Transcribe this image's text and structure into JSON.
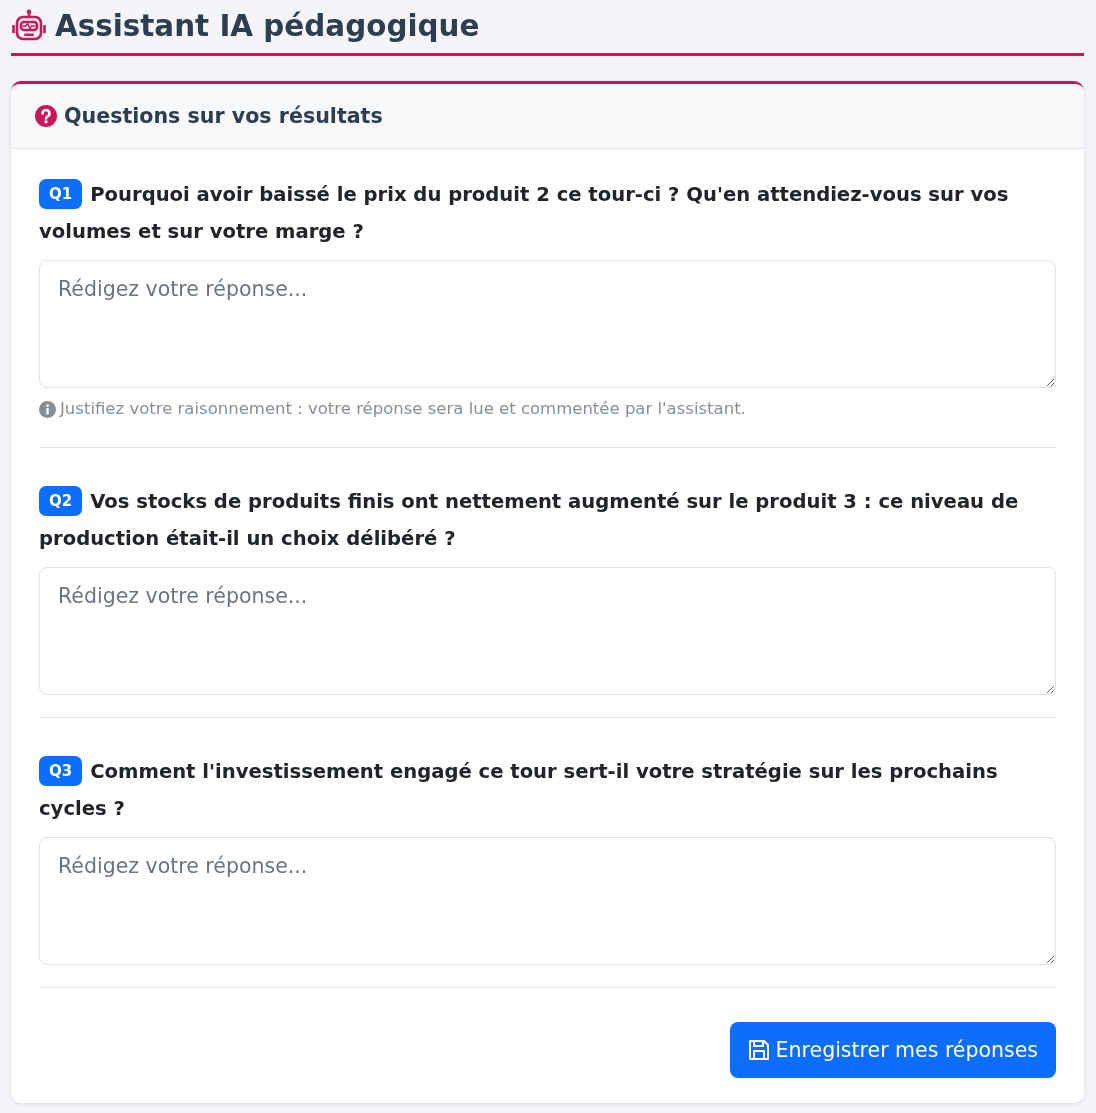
{
  "page": {
    "title": "Assistant IA pédagogique"
  },
  "card": {
    "title": "Questions sur vos résultats",
    "questions": [
      {
        "badge": "Q1",
        "text": "Pourquoi avoir baissé le prix du produit 2 ce tour-ci ? Qu'en attendiez-vous sur vos volumes et sur votre marge ?",
        "placeholder": "Rédigez votre réponse...",
        "hint": "Justifiez votre raisonnement : votre réponse sera lue et commentée par l'assistant."
      },
      {
        "badge": "Q2",
        "text": "Vos stocks de produits finis ont nettement augmenté sur le produit 3 : ce niveau de production était-il un choix délibéré ?",
        "placeholder": "Rédigez votre réponse..."
      },
      {
        "badge": "Q3",
        "text": "Comment l'investissement engagé ce tour sert-il votre stratégie sur les prochains cycles ?",
        "placeholder": "Rédigez votre réponse..."
      }
    ],
    "save_button": {
      "label": "Enregistrer mes réponses"
    }
  }
}
